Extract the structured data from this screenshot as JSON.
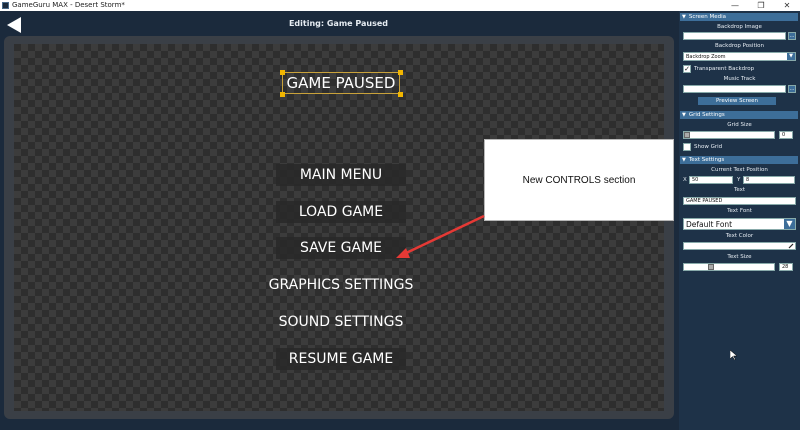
{
  "window": {
    "title": "GameGuru MAX - Desert Storm*",
    "minimize_glyph": "—",
    "maximize_glyph": "❐",
    "close_glyph": "✕"
  },
  "editor": {
    "title": "Editing: Game Paused",
    "back_icon": "back-arrow-icon"
  },
  "canvas": {
    "selected_text": "GAME PAUSED",
    "menu": [
      {
        "label": "MAIN MENU",
        "boxed": true
      },
      {
        "label": "LOAD GAME",
        "boxed": true
      },
      {
        "label": "SAVE GAME",
        "boxed": true
      },
      {
        "label": "GRAPHICS SETTINGS",
        "boxed": false
      },
      {
        "label": "SOUND SETTINGS",
        "boxed": false
      },
      {
        "label": "RESUME GAME",
        "boxed": true
      }
    ]
  },
  "annotation": {
    "callout_text": "New CONTROLS section",
    "arrow_color": "#e53935"
  },
  "panel": {
    "screen_media": {
      "header": "Screen Media",
      "backdrop_image_label": "Backdrop Image",
      "backdrop_image_value": "",
      "browse_label": "...",
      "backdrop_position_label": "Backdrop Position",
      "backdrop_position_value": "Backdrop Zoom",
      "transparent_backdrop_label": "Transparent Backdrop",
      "transparent_backdrop_checked": true,
      "music_track_label": "Music Track",
      "music_track_value": "",
      "preview_button": "Preview Screen"
    },
    "grid_settings": {
      "header": "Grid Settings",
      "grid_size_label": "Grid Size",
      "grid_size_value": "0",
      "show_grid_label": "Show Grid",
      "show_grid_checked": false
    },
    "text_settings": {
      "header": "Text Settings",
      "position_label": "Current Text Position",
      "x_label": "X",
      "x_value": "50",
      "y_label": "Y",
      "y_value": "8",
      "text_label": "Text",
      "text_value": "GAME PAUSED",
      "font_label": "Text Font",
      "font_value": "Default Font",
      "color_label": "Text Color",
      "size_label": "Text Size",
      "size_value": "28",
      "size_fraction": 0.28
    }
  },
  "colors": {
    "background": "#1b2a3c",
    "panel": "#1e3248",
    "section_header": "#3d6e99",
    "selection_handle": "#f2b600"
  }
}
